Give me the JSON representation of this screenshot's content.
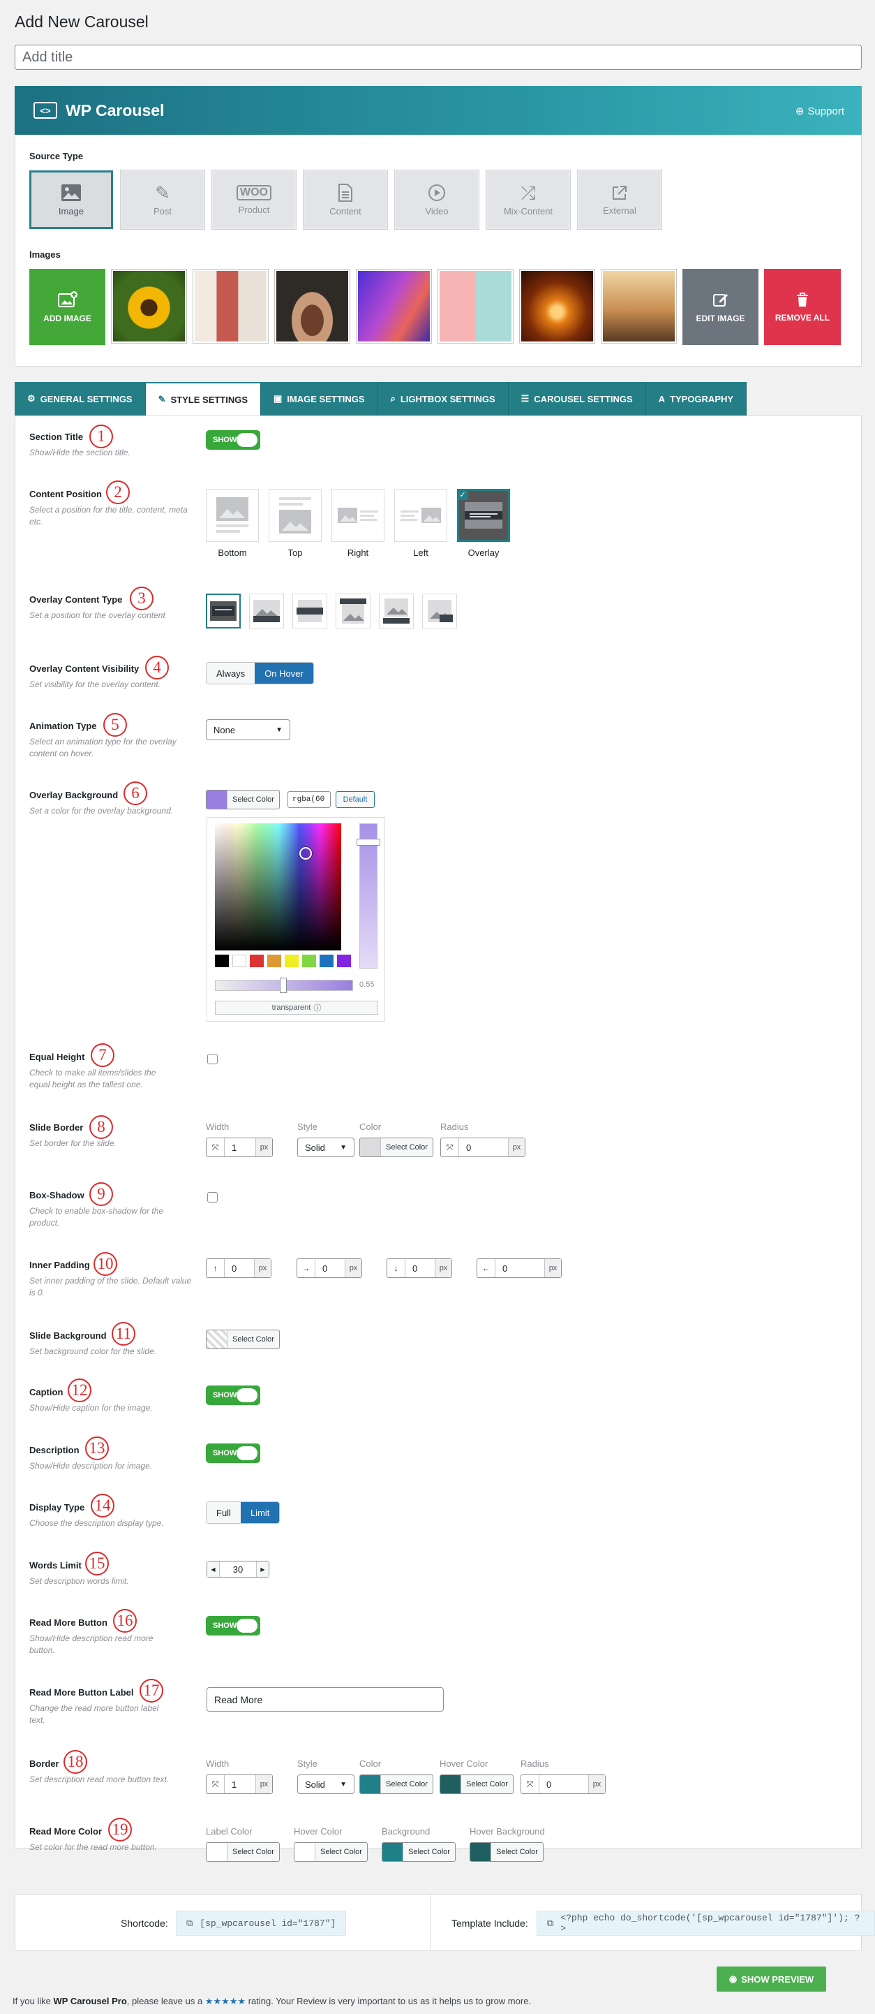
{
  "page": {
    "title": "Add New Carousel",
    "title_placeholder": "Add title"
  },
  "banner": {
    "brand": "WP Carousel",
    "brand_icon": "code-box-icon",
    "support": "Support"
  },
  "source": {
    "label": "Source Type",
    "options": [
      {
        "label": "Image",
        "icon": "image-icon",
        "active": true
      },
      {
        "label": "Post",
        "icon": "pin-icon"
      },
      {
        "label": "Product",
        "icon": "woo-icon",
        "icon_text": "WOO"
      },
      {
        "label": "Content",
        "icon": "document-icon"
      },
      {
        "label": "Video",
        "icon": "play-icon"
      },
      {
        "label": "Mix-Content",
        "icon": "shuffle-icon"
      },
      {
        "label": "External",
        "icon": "external-link-icon"
      }
    ]
  },
  "images": {
    "label": "Images",
    "add": "ADD IMAGE",
    "edit": "EDIT IMAGE",
    "remove": "REMOVE ALL",
    "thumbs": [
      "sunflower",
      "cactus",
      "seedling in hands",
      "neon portrait",
      "pink earrings",
      "orange lamp",
      "cathedral"
    ]
  },
  "tabs": [
    {
      "label": "GENERAL SETTINGS",
      "icon": "gear-icon"
    },
    {
      "label": "STYLE SETTINGS",
      "icon": "brush-icon",
      "active": true
    },
    {
      "label": "IMAGE SETTINGS",
      "icon": "image-icon"
    },
    {
      "label": "LIGHTBOX SETTINGS",
      "icon": "search-icon"
    },
    {
      "label": "CAROUSEL SETTINGS",
      "icon": "sliders-icon"
    },
    {
      "label": "TYPOGRAPHY",
      "icon": "font-icon"
    }
  ],
  "fields": {
    "section_title": {
      "n": "1",
      "label": "Section Title",
      "desc": "Show/Hide the section title.",
      "toggle": "SHOW"
    },
    "content_position": {
      "n": "2",
      "label": "Content Position",
      "desc": "Select a position for the title, content, meta etc.",
      "options": [
        "Bottom",
        "Top",
        "Right",
        "Left",
        "Overlay"
      ]
    },
    "overlay_type": {
      "n": "3",
      "label": "Overlay Content Type",
      "desc": "Set a position for the overlay content"
    },
    "overlay_visibility": {
      "n": "4",
      "label": "Overlay Content Visibility",
      "desc": "Set visibility for the overlay content.",
      "options": [
        "Always",
        "On Hover"
      ]
    },
    "animation": {
      "n": "5",
      "label": "Animation Type",
      "desc": "Select an animation type for the overlay content on hover.",
      "value": "None"
    },
    "overlay_bg": {
      "n": "6",
      "label": "Overlay Background",
      "desc": "Set a color for the overlay background.",
      "select": "Select Color",
      "value": "rgba(60",
      "default": "Default",
      "alpha": "0.55",
      "transparent": "transparent",
      "color": "#9a7fe0"
    },
    "equal_height": {
      "n": "7",
      "label": "Equal Height",
      "desc": "Check to make all items/slides the equal height as the tallest one."
    },
    "slide_border": {
      "n": "8",
      "label": "Slide Border",
      "desc": "Set border for the slide.",
      "width_label": "Width",
      "width": "1",
      "style_label": "Style",
      "style": "Solid",
      "color_label": "Color",
      "select": "Select Color",
      "radius_label": "Radius",
      "radius": "0",
      "unit": "px"
    },
    "box_shadow": {
      "n": "9",
      "label": "Box-Shadow",
      "desc": "Check to enable box-shadow for the product."
    },
    "inner_padding": {
      "n": "10",
      "label": "Inner Padding",
      "desc": "Set inner padding of the slide. Default value is 0.",
      "values": [
        "0",
        "0",
        "0",
        "0"
      ],
      "unit": "px"
    },
    "slide_bg": {
      "n": "11",
      "label": "Slide Background",
      "desc": "Set background color for the slide.",
      "select": "Select Color"
    },
    "caption": {
      "n": "12",
      "label": "Caption",
      "desc": "Show/Hide caption for the image.",
      "toggle": "SHOW"
    },
    "description": {
      "n": "13",
      "label": "Description",
      "desc": "Show/Hide description for image.",
      "toggle": "SHOW"
    },
    "display_type": {
      "n": "14",
      "label": "Display Type",
      "desc": "Choose the description display type.",
      "options": [
        "Full",
        "Limit"
      ]
    },
    "words_limit": {
      "n": "15",
      "label": "Words Limit",
      "desc": "Set description words limit.",
      "value": "30"
    },
    "read_more": {
      "n": "16",
      "label": "Read More Button",
      "desc": "Show/Hide description read more button.",
      "toggle": "SHOW"
    },
    "read_more_label": {
      "n": "17",
      "label": "Read More Button Label",
      "desc": "Change the read more button label text.",
      "value": "Read More"
    },
    "border": {
      "n": "18",
      "label": "Border",
      "desc": "Set description read more button text.",
      "width_label": "Width",
      "width": "1",
      "style_label": "Style",
      "style": "Solid",
      "color_label": "Color",
      "hover_label": "Hover Color",
      "select": "Select Color",
      "radius_label": "Radius",
      "radius": "0",
      "unit": "px",
      "color": "#1f8088",
      "hover": "#1f5f5f"
    },
    "read_more_color": {
      "n": "19",
      "label": "Read More Color",
      "desc": "Set color for the read more button.",
      "labels": [
        "Label Color",
        "Hover Color",
        "Background",
        "Hover Background"
      ],
      "select": "Select Color",
      "colors": [
        "#ffffff",
        "#ffffff",
        "#1f8088",
        "#1f5f5f"
      ]
    }
  },
  "footer": {
    "shortcode_label": "Shortcode:",
    "shortcode": "[sp_wpcarousel id=\"1787\"]",
    "template_label": "Template Include:",
    "template": "<?php echo do_shortcode('[sp_wpcarousel id=\"1787\"]'); ?>",
    "preview": "SHOW PREVIEW",
    "credit_pre": "If you like ",
    "credit_brand": "WP Carousel Pro",
    "credit_mid": ", please leave us a ",
    "stars": "★★★★★",
    "credit_post": " rating. Your Review is very important to us as it helps us to grow more."
  },
  "colors": {
    "accent": "#247e86",
    "add": "#43a838",
    "edit": "#6c757d",
    "remove": "#e0344c",
    "toggle": "#37a93a",
    "blue": "#2271b1"
  }
}
